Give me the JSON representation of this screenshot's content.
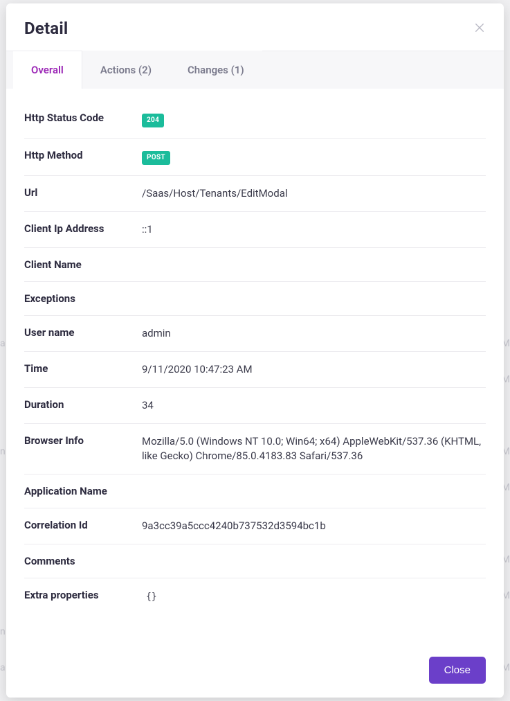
{
  "header": {
    "title": "Detail"
  },
  "tabs": {
    "overall": "Overall",
    "actions": "Actions (2)",
    "changes": "Changes (1)"
  },
  "fields": {
    "http_status_code": {
      "label": "Http Status Code",
      "value": "204"
    },
    "http_method": {
      "label": "Http Method",
      "value": "POST"
    },
    "url": {
      "label": "Url",
      "value": "/Saas/Host/Tenants/EditModal"
    },
    "client_ip": {
      "label": "Client Ip Address",
      "value": "::1"
    },
    "client_name": {
      "label": "Client Name",
      "value": ""
    },
    "exceptions": {
      "label": "Exceptions",
      "value": ""
    },
    "user_name": {
      "label": "User name",
      "value": "admin"
    },
    "time": {
      "label": "Time",
      "value": "9/11/2020 10:47:23 AM"
    },
    "duration": {
      "label": "Duration",
      "value": "34"
    },
    "browser_info": {
      "label": "Browser Info",
      "value": "Mozilla/5.0 (Windows NT 10.0; Win64; x64) AppleWebKit/537.36 (KHTML, like Gecko) Chrome/85.0.4183.83 Safari/537.36"
    },
    "app_name": {
      "label": "Application Name",
      "value": ""
    },
    "correlation_id": {
      "label": "Correlation Id",
      "value": "9a3cc39a5ccc4240b737532d3594bc1b"
    },
    "comments": {
      "label": "Comments",
      "value": ""
    },
    "extra_properties": {
      "label": "Extra properties",
      "value": "{}"
    }
  },
  "footer": {
    "close_label": "Close"
  }
}
